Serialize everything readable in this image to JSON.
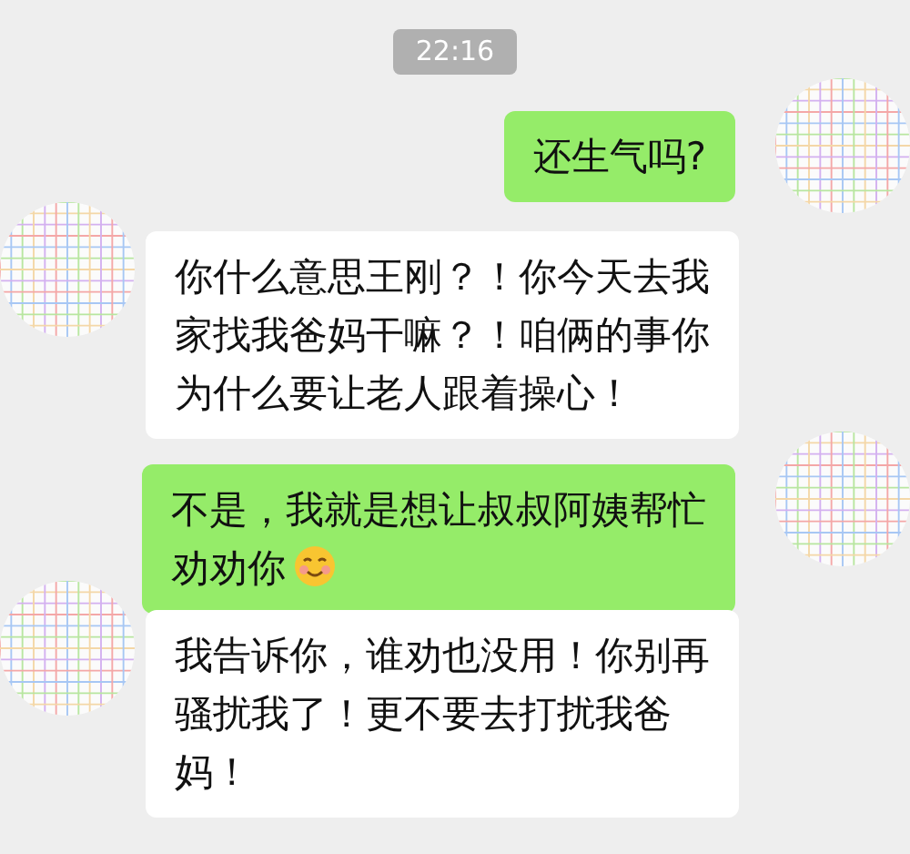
{
  "time": "22:16",
  "messages": [
    {
      "kind": "sent",
      "text": "还生气吗?",
      "has_emoji": false
    },
    {
      "kind": "received",
      "text": "你什么意思王刚？！你今天去我家找我爸妈干嘛？！咱俩的事你为什么要让老人跟着操心！",
      "has_emoji": false
    },
    {
      "kind": "sent",
      "text": "不是，我就是想让叔叔阿姨帮忙劝劝你",
      "has_emoji": true
    },
    {
      "kind": "received",
      "text": "我告诉你，谁劝也没用！你别再骚扰我了！更不要去打扰我爸妈！",
      "has_emoji": false
    }
  ]
}
